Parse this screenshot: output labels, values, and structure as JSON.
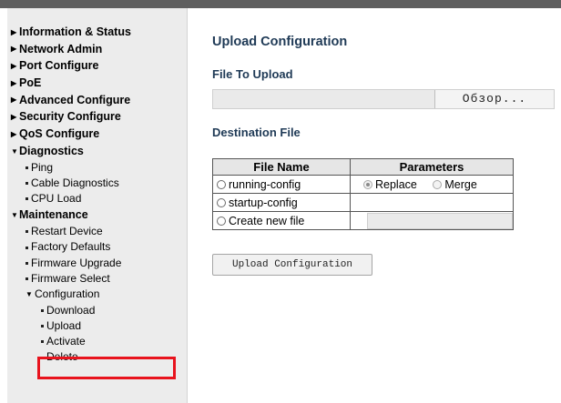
{
  "sidebar": {
    "items": [
      {
        "label": "Information & Status",
        "arrow": "▶"
      },
      {
        "label": "Network Admin",
        "arrow": "▶"
      },
      {
        "label": "Port Configure",
        "arrow": "▶"
      },
      {
        "label": "PoE",
        "arrow": "▶"
      },
      {
        "label": "Advanced Configure",
        "arrow": "▶"
      },
      {
        "label": "Security Configure",
        "arrow": "▶"
      },
      {
        "label": "QoS Configure",
        "arrow": "▶"
      }
    ],
    "diagnostics": {
      "label": "Diagnostics",
      "arrow": "▼",
      "children": [
        "Ping",
        "Cable Diagnostics",
        "CPU Load"
      ]
    },
    "maintenance": {
      "label": "Maintenance",
      "arrow": "▼",
      "children": [
        "Restart Device",
        "Factory Defaults",
        "Firmware Upgrade",
        "Firmware Select"
      ],
      "configuration": {
        "label": "Configuration",
        "arrow": "▼",
        "children": [
          "Download",
          "Upload",
          "Activate",
          "Delete"
        ]
      }
    }
  },
  "main": {
    "title": "Upload Configuration",
    "file_section": "File To Upload",
    "browse_label": "Обзор...",
    "dest_section": "Destination File",
    "table": {
      "headers": [
        "File Name",
        "Parameters"
      ],
      "running_config": "running-config",
      "startup_config": "startup-config",
      "create_new": "Create new file",
      "replace": "Replace",
      "merge": "Merge"
    },
    "upload_button": "Upload Configuration"
  },
  "colors": {
    "heading": "#1f3a56",
    "highlight": "#e8131d",
    "sidebar_bg": "#ececec",
    "topbar": "#5f5f5f"
  }
}
